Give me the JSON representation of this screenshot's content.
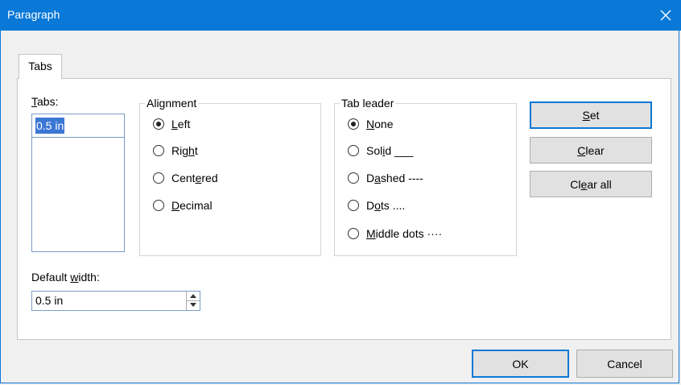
{
  "window": {
    "title": "Paragraph",
    "close_icon": "close-icon"
  },
  "tab": {
    "label": "Tabs"
  },
  "tabs_list": {
    "label_pre": "",
    "label_ul": "T",
    "label_post": "abs:",
    "items": [
      "0.5 in"
    ],
    "selected": "0.5 in"
  },
  "alignment": {
    "title": "Alignment",
    "options": [
      {
        "pre": "",
        "ul": "L",
        "post": "eft",
        "selected": true
      },
      {
        "pre": "Rig",
        "ul": "h",
        "post": "t",
        "selected": false
      },
      {
        "pre": "Cent",
        "ul": "e",
        "post": "red",
        "selected": false
      },
      {
        "pre": "",
        "ul": "D",
        "post": "ecimal",
        "selected": false
      }
    ]
  },
  "tab_leader": {
    "title": "Tab leader",
    "options": [
      {
        "pre": "",
        "ul": "N",
        "post": "one",
        "selected": true
      },
      {
        "pre": "Sol",
        "ul": "i",
        "post": "d ___",
        "selected": false
      },
      {
        "pre": "D",
        "ul": "a",
        "post": "shed ----",
        "selected": false
      },
      {
        "pre": "D",
        "ul": "o",
        "post": "ts ....",
        "selected": false
      },
      {
        "pre": "",
        "ul": "M",
        "post": "iddle dots ····",
        "selected": false
      }
    ]
  },
  "buttons": {
    "set": {
      "pre": "",
      "ul": "S",
      "post": "et"
    },
    "clear": {
      "pre": "",
      "ul": "C",
      "post": "lear"
    },
    "clear_all": {
      "pre": "Cl",
      "ul": "e",
      "post": "ar all"
    },
    "ok": "OK",
    "cancel": "Cancel"
  },
  "default_width": {
    "label_pre": "Default ",
    "label_ul": "w",
    "label_post": "idth:",
    "value": "0.5 in"
  },
  "colors": {
    "titlebar": "#0a78d7",
    "selection": "#3b77d4"
  }
}
